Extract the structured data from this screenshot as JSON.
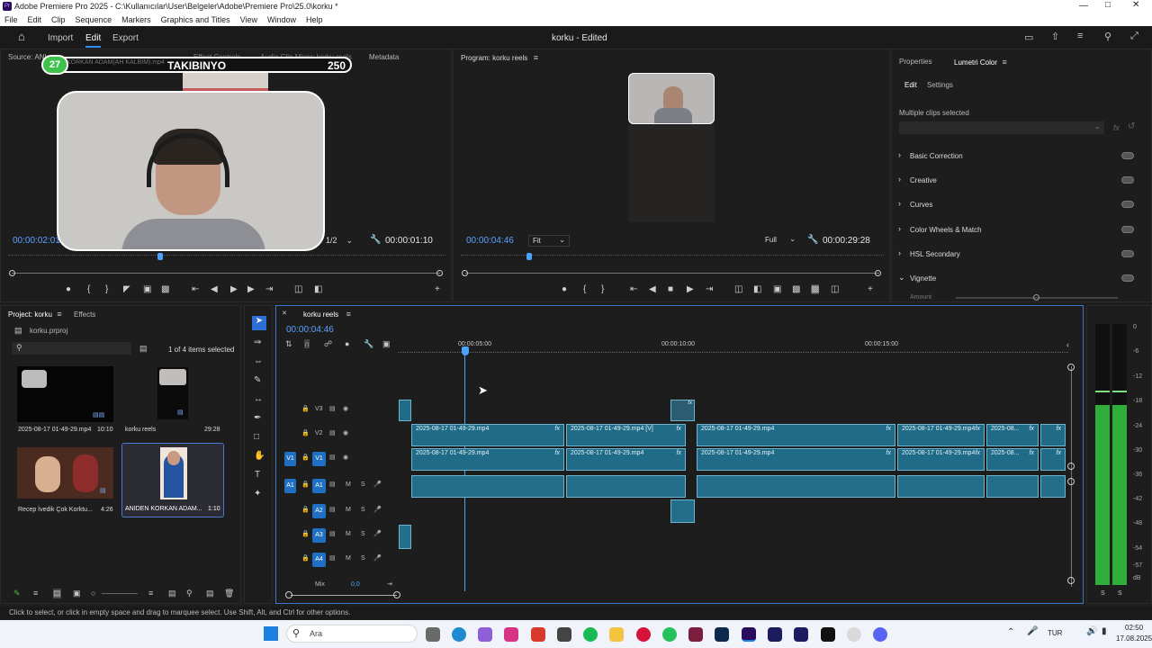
{
  "window": {
    "title": "Adobe Premiere Pro 2025 - C:\\Kullanıcılar\\User\\Belgeler\\Adobe\\Premiere Pro\\25.0\\korku *"
  },
  "menu": [
    "File",
    "Edit",
    "Clip",
    "Sequence",
    "Markers",
    "Graphics and Titles",
    "View",
    "Window",
    "Help"
  ],
  "header": {
    "tabs": [
      "Import",
      "Edit",
      "Export"
    ],
    "active": "Edit",
    "doc_title": "korku",
    "doc_status": "- Edited"
  },
  "source": {
    "tab": "Source: ANIDEN KORKAN ADAM(AH KALBIM).mp4",
    "tab_prefix": "Source: ANI",
    "effect_controls": "Effect Controls",
    "audio_mixer": "Audio Clip Mixer: korku reels",
    "metadata": "Metadata",
    "timecode_in": "00:00:02:01",
    "resolution": "1/2",
    "timecode_dur": "00:00:01:10",
    "overlay_badge": "27",
    "overlay_name": "TAKIBINYO",
    "overlay_score": "250",
    "overlay_caption": "KORKAN ADAM(AH KALBIM).mp4"
  },
  "program": {
    "tab": "Program: korku reels",
    "timecode": "00:00:04:46",
    "fit": "Fit",
    "quality": "Full",
    "duration": "00:00:29:28"
  },
  "right_panel": {
    "tab_properties": "Properties",
    "tab_lumetri": "Lumetri Color",
    "sub_edit": "Edit",
    "sub_settings": "Settings",
    "status": "Multiple clips selected",
    "sections": [
      "Basic Correction",
      "Creative",
      "Curves",
      "Color Wheels & Match",
      "HSL Secondary",
      "Vignette"
    ],
    "amount_label": "Amount"
  },
  "project": {
    "tab": "Project: korku",
    "effects": "Effects",
    "file": "korku.prproj",
    "count": "1 of 4 items selected",
    "items": [
      {
        "name": "2025-08-17 01-49-29.mp4",
        "dur": "10:10"
      },
      {
        "name": "korku reels",
        "dur": "29:28"
      },
      {
        "name": "Recep İvedik Çok Korktu...",
        "dur": "4:26"
      },
      {
        "name": "ANIDEN KORKAN ADAM...",
        "dur": "1:10"
      }
    ]
  },
  "timeline": {
    "tab": "korku reels",
    "timecode": "00:00:04:46",
    "ruler": [
      "00:00:05:00",
      "00:00:10:00",
      "00:00:15:00"
    ],
    "tracks": {
      "v3": "V3",
      "v2": "V2",
      "v1": "V1",
      "a1": "A1",
      "a2": "A2",
      "a3": "A3",
      "a4": "A4",
      "src_v1": "V1",
      "src_a1": "A1",
      "m": "M",
      "s": "S"
    },
    "mix_label": "Mix",
    "mix_value": "0,0",
    "v2_clips": [
      "2025-08-17 01-49-29.mp4",
      "2025-08-17 01-49-29.mp4 [V]",
      "2025-08-17 01-49-29.mp4",
      "2025-08-17 01-49-29.mp4",
      "2025-08...",
      ""
    ],
    "v1_clips": [
      "2025-08-17 01-49-29.mp4",
      "2025-08-17 01-49-29.mp4",
      "2025-08-17 01-49-29.mp4",
      "2025-08-17 01-49-29.mp4",
      "2025-08...",
      ""
    ],
    "fx": "fx"
  },
  "meter": {
    "scale": [
      "0",
      "-6",
      "-12",
      "-18",
      "-24",
      "-30",
      "-36",
      "-42",
      "-48",
      "-54",
      "-57",
      "dB"
    ],
    "foot_l": "S",
    "foot_r": "S"
  },
  "status_bar": "Click to select, or click in empty space and drag to marquee select. Use Shift, Alt, and Ctrl for other options.",
  "taskbar": {
    "search": "Ara",
    "lang": "TUR",
    "time": "02:50",
    "date": "17.08.2025"
  },
  "colors": {
    "accent": "#2d8ceb",
    "clip": "#1f6b88",
    "playhead": "#4aa3ff",
    "meter": "#2fae3c"
  }
}
